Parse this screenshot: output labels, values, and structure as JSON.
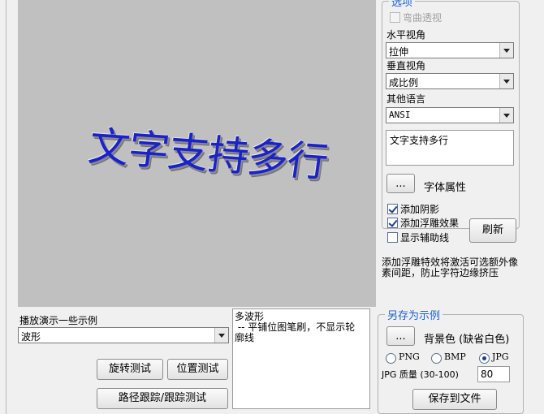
{
  "preview": {
    "text": "文字支持多行",
    "text_color": "#1a22c8",
    "background": "#c0c0c0"
  },
  "options": {
    "legend": "选项",
    "curve_perspective_label": "弯曲透视",
    "horizontal_view_label": "水平视角",
    "horizontal_view_value": "拉伸",
    "vertical_view_label": "垂直视角",
    "vertical_view_value": "成比例",
    "other_language_label": "其他语言",
    "other_language_value": "ANSI",
    "text_input_value": "文字支持多行",
    "font_button_label": "...",
    "font_props_label": "字体属性",
    "add_shadow_label": "添加阴影",
    "add_shadow_checked": true,
    "add_emboss_label": "添加浮雕效果",
    "add_emboss_checked": true,
    "show_guides_label": "显示辅助线",
    "show_guides_checked": false,
    "refresh_label": "刷新"
  },
  "hint_text": "添加浮雕特效将激活可选额外像素间距，防止字符边缘挤压",
  "demos": {
    "label": "播放演示一些示例",
    "selected": "波形",
    "description": "多波形\n -- 平铺位图笔刷，不显示轮廓线",
    "rotate_test_label": "旋转测试",
    "position_test_label": "位置测试",
    "path_test_label": "路径跟踪/跟踪测试"
  },
  "save": {
    "legend": "另存为示例",
    "bg_button_label": "...",
    "bg_label": "背景色 (缺省白色)",
    "formats": [
      {
        "label": "PNG",
        "checked": false
      },
      {
        "label": "BMP",
        "checked": false
      },
      {
        "label": "JPG",
        "checked": true
      }
    ],
    "quality_label": "JPG 质量 (30-100)",
    "quality_value": "80",
    "save_button_label": "保存到文件"
  },
  "colors": {
    "accent": "#1c5fd1"
  }
}
